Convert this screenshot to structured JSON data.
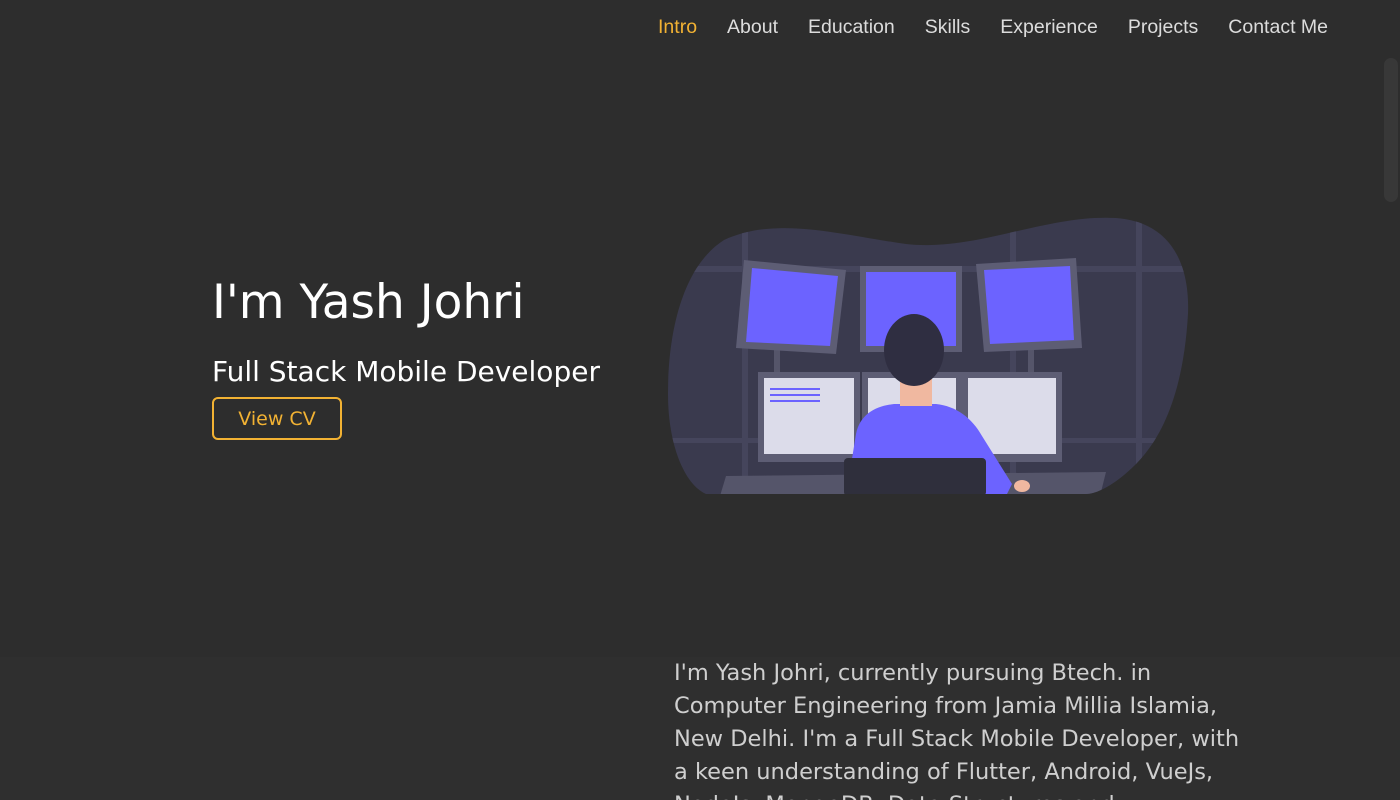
{
  "nav": {
    "items": [
      {
        "label": "Intro",
        "active": true
      },
      {
        "label": "About",
        "active": false
      },
      {
        "label": "Education",
        "active": false
      },
      {
        "label": "Skills",
        "active": false
      },
      {
        "label": "Experience",
        "active": false
      },
      {
        "label": "Projects",
        "active": false
      },
      {
        "label": "Contact Me",
        "active": false
      }
    ]
  },
  "hero": {
    "name": "I'm Yash Johri",
    "role": "Full Stack Mobile Developer",
    "cv_button_label": "View CV",
    "illustration_icon": "developer-at-monitors-illustration"
  },
  "about": {
    "text": "I'm Yash Johri, currently pursuing Btech. in Computer Engineering from Jamia Millia Islamia, New Delhi. I'm a Full Stack Mobile Developer, with a keen understanding of Flutter, Android, VueJs, NodeJs, MongoDB, Data Structures and"
  },
  "colors": {
    "background": "#2d2d2d",
    "accent": "#f2b233",
    "illustration_purple": "#6c63ff",
    "illustration_blob": "#3a3a4e"
  }
}
